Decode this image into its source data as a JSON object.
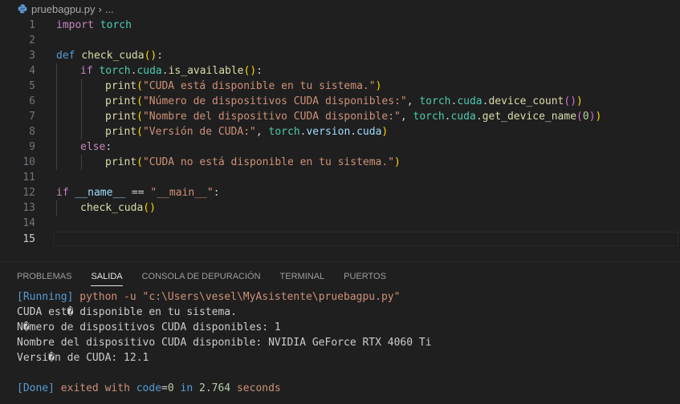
{
  "breadcrumb": {
    "file": "pruebagpu.py",
    "sep": "›",
    "more": "..."
  },
  "editor": {
    "line_numbers": [
      "1",
      "2",
      "3",
      "4",
      "5",
      "6",
      "7",
      "8",
      "9",
      "10",
      "11",
      "12",
      "13",
      "14",
      "15"
    ],
    "active_line": "15",
    "code": {
      "l1": {
        "import": "import",
        "torch": "torch"
      },
      "l3": {
        "def": "def",
        "name": "check_cuda",
        "p_open": "(",
        "p_close": ")",
        "colon": ":"
      },
      "l4": {
        "if": "if",
        "torch": "torch",
        "dot1": ".",
        "cuda": "cuda",
        "dot2": ".",
        "fn": "is_available",
        "p_open": "(",
        "p_close": ")",
        "colon": ":"
      },
      "l5": {
        "fn": "print",
        "p_open": "(",
        "str": "\"CUDA está disponible en tu sistema.\"",
        "p_close": ")"
      },
      "l6": {
        "fn": "print",
        "p_open": "(",
        "str": "\"Número de dispositivos CUDA disponibles:\"",
        "comma": ", ",
        "torch": "torch",
        "dot1": ".",
        "cuda": "cuda",
        "dot2": ".",
        "fn2": "device_count",
        "p2_open": "(",
        "p2_close": ")",
        "p_close": ")"
      },
      "l7": {
        "fn": "print",
        "p_open": "(",
        "str": "\"Nombre del dispositivo CUDA disponible:\"",
        "comma": ", ",
        "torch": "torch",
        "dot1": ".",
        "cuda": "cuda",
        "dot2": ".",
        "fn2": "get_device_name",
        "p2_open": "(",
        "num": "0",
        "p2_close": ")",
        "p_close": ")"
      },
      "l8": {
        "fn": "print",
        "p_open": "(",
        "str": "\"Versión de CUDA:\"",
        "comma": ", ",
        "torch": "torch",
        "dot1": ".",
        "version": "version",
        "dot2": ".",
        "cuda": "cuda",
        "p_close": ")"
      },
      "l9": {
        "else": "else",
        "colon": ":"
      },
      "l10": {
        "fn": "print",
        "p_open": "(",
        "str": "\"CUDA no está disponible en tu sistema.\"",
        "p_close": ")"
      },
      "l12": {
        "if": "if",
        "name": "__name__",
        "eq": " == ",
        "str": "\"__main__\"",
        "colon": ":"
      },
      "l13": {
        "fn": "check_cuda",
        "p_open": "(",
        "p_close": ")"
      }
    }
  },
  "panel": {
    "tabs": [
      "PROBLEMAS",
      "SALIDA",
      "CONSOLA DE DEPURACIÓN",
      "TERMINAL",
      "PUERTOS"
    ],
    "active_tab": "SALIDA"
  },
  "output": {
    "running_tag": "[Running]",
    "command": "python -u \"c:\\Users\\vesel\\MyAsistente\\pruebagpu.py\"",
    "lines": [
      "CUDA est� disponible en tu sistema.",
      "N�mero de dispositivos CUDA disponibles: 1",
      "Nombre del dispositivo CUDA disponible: NVIDIA GeForce RTX 4060 Ti",
      "Versi�n de CUDA: 12.1"
    ],
    "done": {
      "tag": "[Done]",
      "exited_with": "exited with",
      "code_kw": "code",
      "eq": "=",
      "code": "0",
      "in": "in",
      "seconds_value": "2.764",
      "seconds_label": "seconds"
    }
  },
  "colors": {
    "background": "#1f1f1f",
    "keyword": "#c586c0",
    "def_keyword": "#569cd6",
    "function": "#dcdcaa",
    "variable": "#9cdcfe",
    "module": "#4ec9b0",
    "string": "#ce9178",
    "number": "#b5cea8",
    "bracket1": "#ffd700",
    "bracket2": "#da70d6"
  }
}
